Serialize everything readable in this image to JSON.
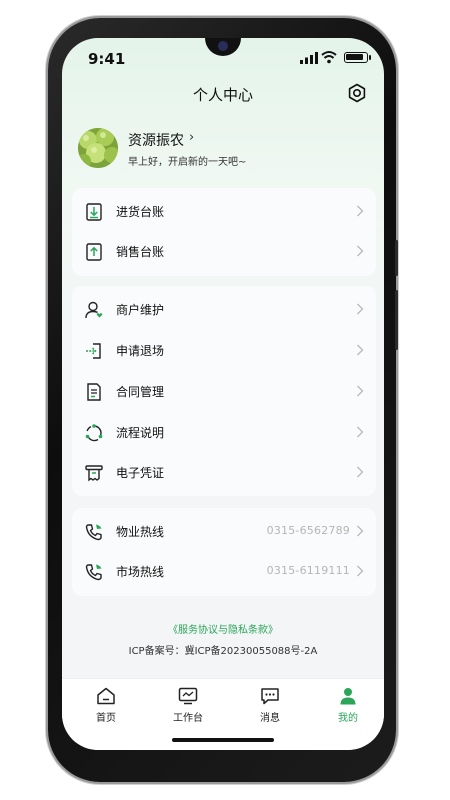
{
  "status": {
    "time": "9:41"
  },
  "header": {
    "title": "个人中心"
  },
  "user": {
    "name": "资源振农",
    "chevron": "›",
    "greeting": "早上好，开启新的一天吧~"
  },
  "ledger": {
    "items": [
      {
        "label": "进货台账",
        "icon": "inbound-doc-icon"
      },
      {
        "label": "销售台账",
        "icon": "outbound-doc-icon"
      }
    ]
  },
  "services": {
    "items": [
      {
        "label": "商户维护",
        "icon": "merchant-user-icon"
      },
      {
        "label": "申请退场",
        "icon": "exit-icon"
      },
      {
        "label": "合同管理",
        "icon": "contract-icon"
      },
      {
        "label": "流程说明",
        "icon": "process-icon"
      },
      {
        "label": "电子凭证",
        "icon": "receipt-icon"
      }
    ]
  },
  "hotlines": {
    "items": [
      {
        "label": "物业热线",
        "value": "0315-6562789",
        "icon": "phone-icon"
      },
      {
        "label": "市场热线",
        "value": "0315-6119111",
        "icon": "phone-icon"
      }
    ]
  },
  "footer": {
    "agreement": "《服务协议与隐私条款》",
    "icp": "ICP备案号：冀ICP备20230055088号-2A"
  },
  "tabbar": {
    "tabs": [
      {
        "label": "首页",
        "icon": "home-icon"
      },
      {
        "label": "工作台",
        "icon": "workbench-icon"
      },
      {
        "label": "消息",
        "icon": "message-icon"
      },
      {
        "label": "我的",
        "icon": "profile-icon",
        "active": true
      }
    ]
  },
  "colors": {
    "accent": "#2aa55a",
    "text": "#111111",
    "muted": "#b5b5b5"
  }
}
